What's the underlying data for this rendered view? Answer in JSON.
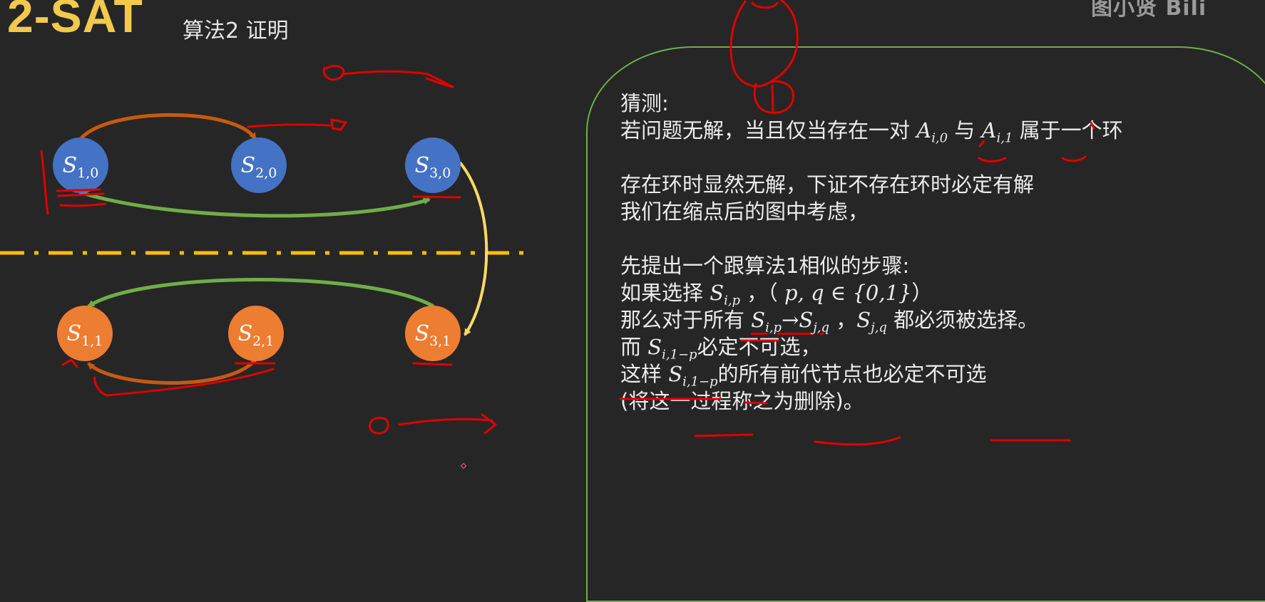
{
  "header": {
    "title": "2-SAT",
    "subtitle": "算法2 证明",
    "brand": "图小贤 Bili"
  },
  "diagram": {
    "nodes": [
      {
        "id": "S10",
        "var": "S",
        "sub": "1,0",
        "group": "top"
      },
      {
        "id": "S20",
        "var": "S",
        "sub": "2,0",
        "group": "top"
      },
      {
        "id": "S30",
        "var": "S",
        "sub": "3,0",
        "group": "top"
      },
      {
        "id": "S11",
        "var": "S",
        "sub": "1,1",
        "group": "bottom"
      },
      {
        "id": "S21",
        "var": "S",
        "sub": "2,1",
        "group": "bottom"
      },
      {
        "id": "S31",
        "var": "S",
        "sub": "3,1",
        "group": "bottom"
      }
    ],
    "edges": [
      {
        "from": "S10",
        "to": "S20",
        "color": "orange"
      },
      {
        "from": "S10",
        "to": "S30",
        "color": "green"
      },
      {
        "from": "S30",
        "to": "S31",
        "color": "yellow"
      },
      {
        "from": "S31",
        "to": "S11",
        "color": "green"
      },
      {
        "from": "S21",
        "to": "S11",
        "color": "orange"
      }
    ],
    "colors": {
      "top_node": "#4472c4",
      "bottom_node": "#ed7d31",
      "orange_edge": "#c55a11",
      "green_edge": "#70ad47",
      "yellow_edge": "#ffd966",
      "divider": "#ffc000",
      "panel_border": "#70ad47",
      "ink": "#e00000"
    }
  },
  "panel_text": {
    "l1": "猜测:",
    "l2a": "若问题无解，当且仅当存在一对 ",
    "l2_A0": "A",
    "l2_A0_sub": "i,0",
    "l2b": " 与 ",
    "l2_A1": "A",
    "l2_A1_sub": "i,1",
    "l2c": " 属于一个环",
    "l3": "存在环时显然无解，下证不存在环时必定有解",
    "l4": "我们在缩点后的图中考虑，",
    "l5": "先提出一个跟算法1相似的步骤:",
    "l6a": "如果选择 ",
    "l6_S": "S",
    "l6_S_sub": "i,p",
    "l6b": " ，（ ",
    "l6_math": "p, q ∈ {0,1}",
    "l6c": "）",
    "l7a": "那么对于所有 ",
    "l7_S1": "S",
    "l7_S1_sub": "i,p",
    "l7_arrow": "→",
    "l7_S2": "S",
    "l7_S2_sub": "j,q",
    "l7b": " ，",
    "l7_S3": "S",
    "l7_S3_sub": "j,q",
    "l7c": " 都必须被选择。",
    "l8a": "而 ",
    "l8_S": "S",
    "l8_S_sub": "i,1−p",
    "l8b": "必定不可选，",
    "l9a": "这样 ",
    "l9_S": "S",
    "l9_S_sub": "i,1−p",
    "l9b": "的所有前代节点也必定不可选",
    "l10": "(将这一过程称之为删除)。"
  }
}
